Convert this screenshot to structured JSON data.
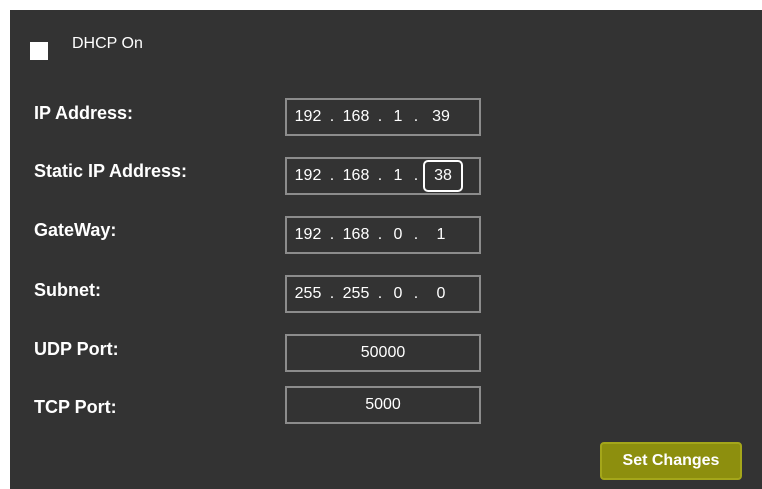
{
  "dhcp": {
    "label": "DHCP On",
    "checked": false
  },
  "fields": {
    "ip_address": {
      "label": "IP Address:",
      "octets": [
        "192",
        "168",
        "1",
        "39"
      ]
    },
    "static_ip": {
      "label": "Static IP Address:",
      "octets": [
        "192",
        "168",
        "1",
        "38"
      ]
    },
    "gateway": {
      "label": "GateWay:",
      "octets": [
        "192",
        "168",
        "0",
        "1"
      ]
    },
    "subnet": {
      "label": "Subnet:",
      "octets": [
        "255",
        "255",
        "0",
        "0"
      ]
    },
    "udp_port": {
      "label": "UDP Port:",
      "value": "50000"
    },
    "tcp_port": {
      "label": "TCP Port:",
      "value": "5000"
    }
  },
  "separator": ".",
  "set_changes_label": "Set Changes",
  "colors": {
    "panel": "#333333",
    "button": "#8d8f0e",
    "field_border": "#8c8c8c"
  }
}
